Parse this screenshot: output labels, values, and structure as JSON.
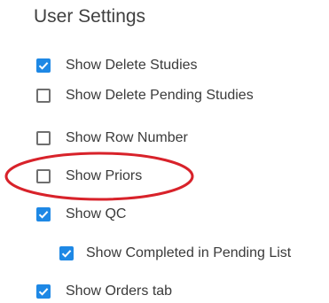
{
  "settings": {
    "title": "User Settings",
    "items": [
      {
        "label": "Show Delete Studies",
        "checked": true
      },
      {
        "label": "Show Delete Pending Studies",
        "checked": false
      },
      {
        "label": "Show Row Number",
        "checked": false
      },
      {
        "label": "Show Priors",
        "checked": false
      },
      {
        "label": "Show QC",
        "checked": true
      },
      {
        "label": "Show Completed in Pending List",
        "checked": true
      },
      {
        "label": "Show Orders tab",
        "checked": true
      }
    ]
  },
  "colors": {
    "checkbox_checked": "#1e88e5",
    "checkbox_border": "#6f6f6f",
    "annotation_ellipse": "#d8222a",
    "text": "#3a3a3a"
  }
}
